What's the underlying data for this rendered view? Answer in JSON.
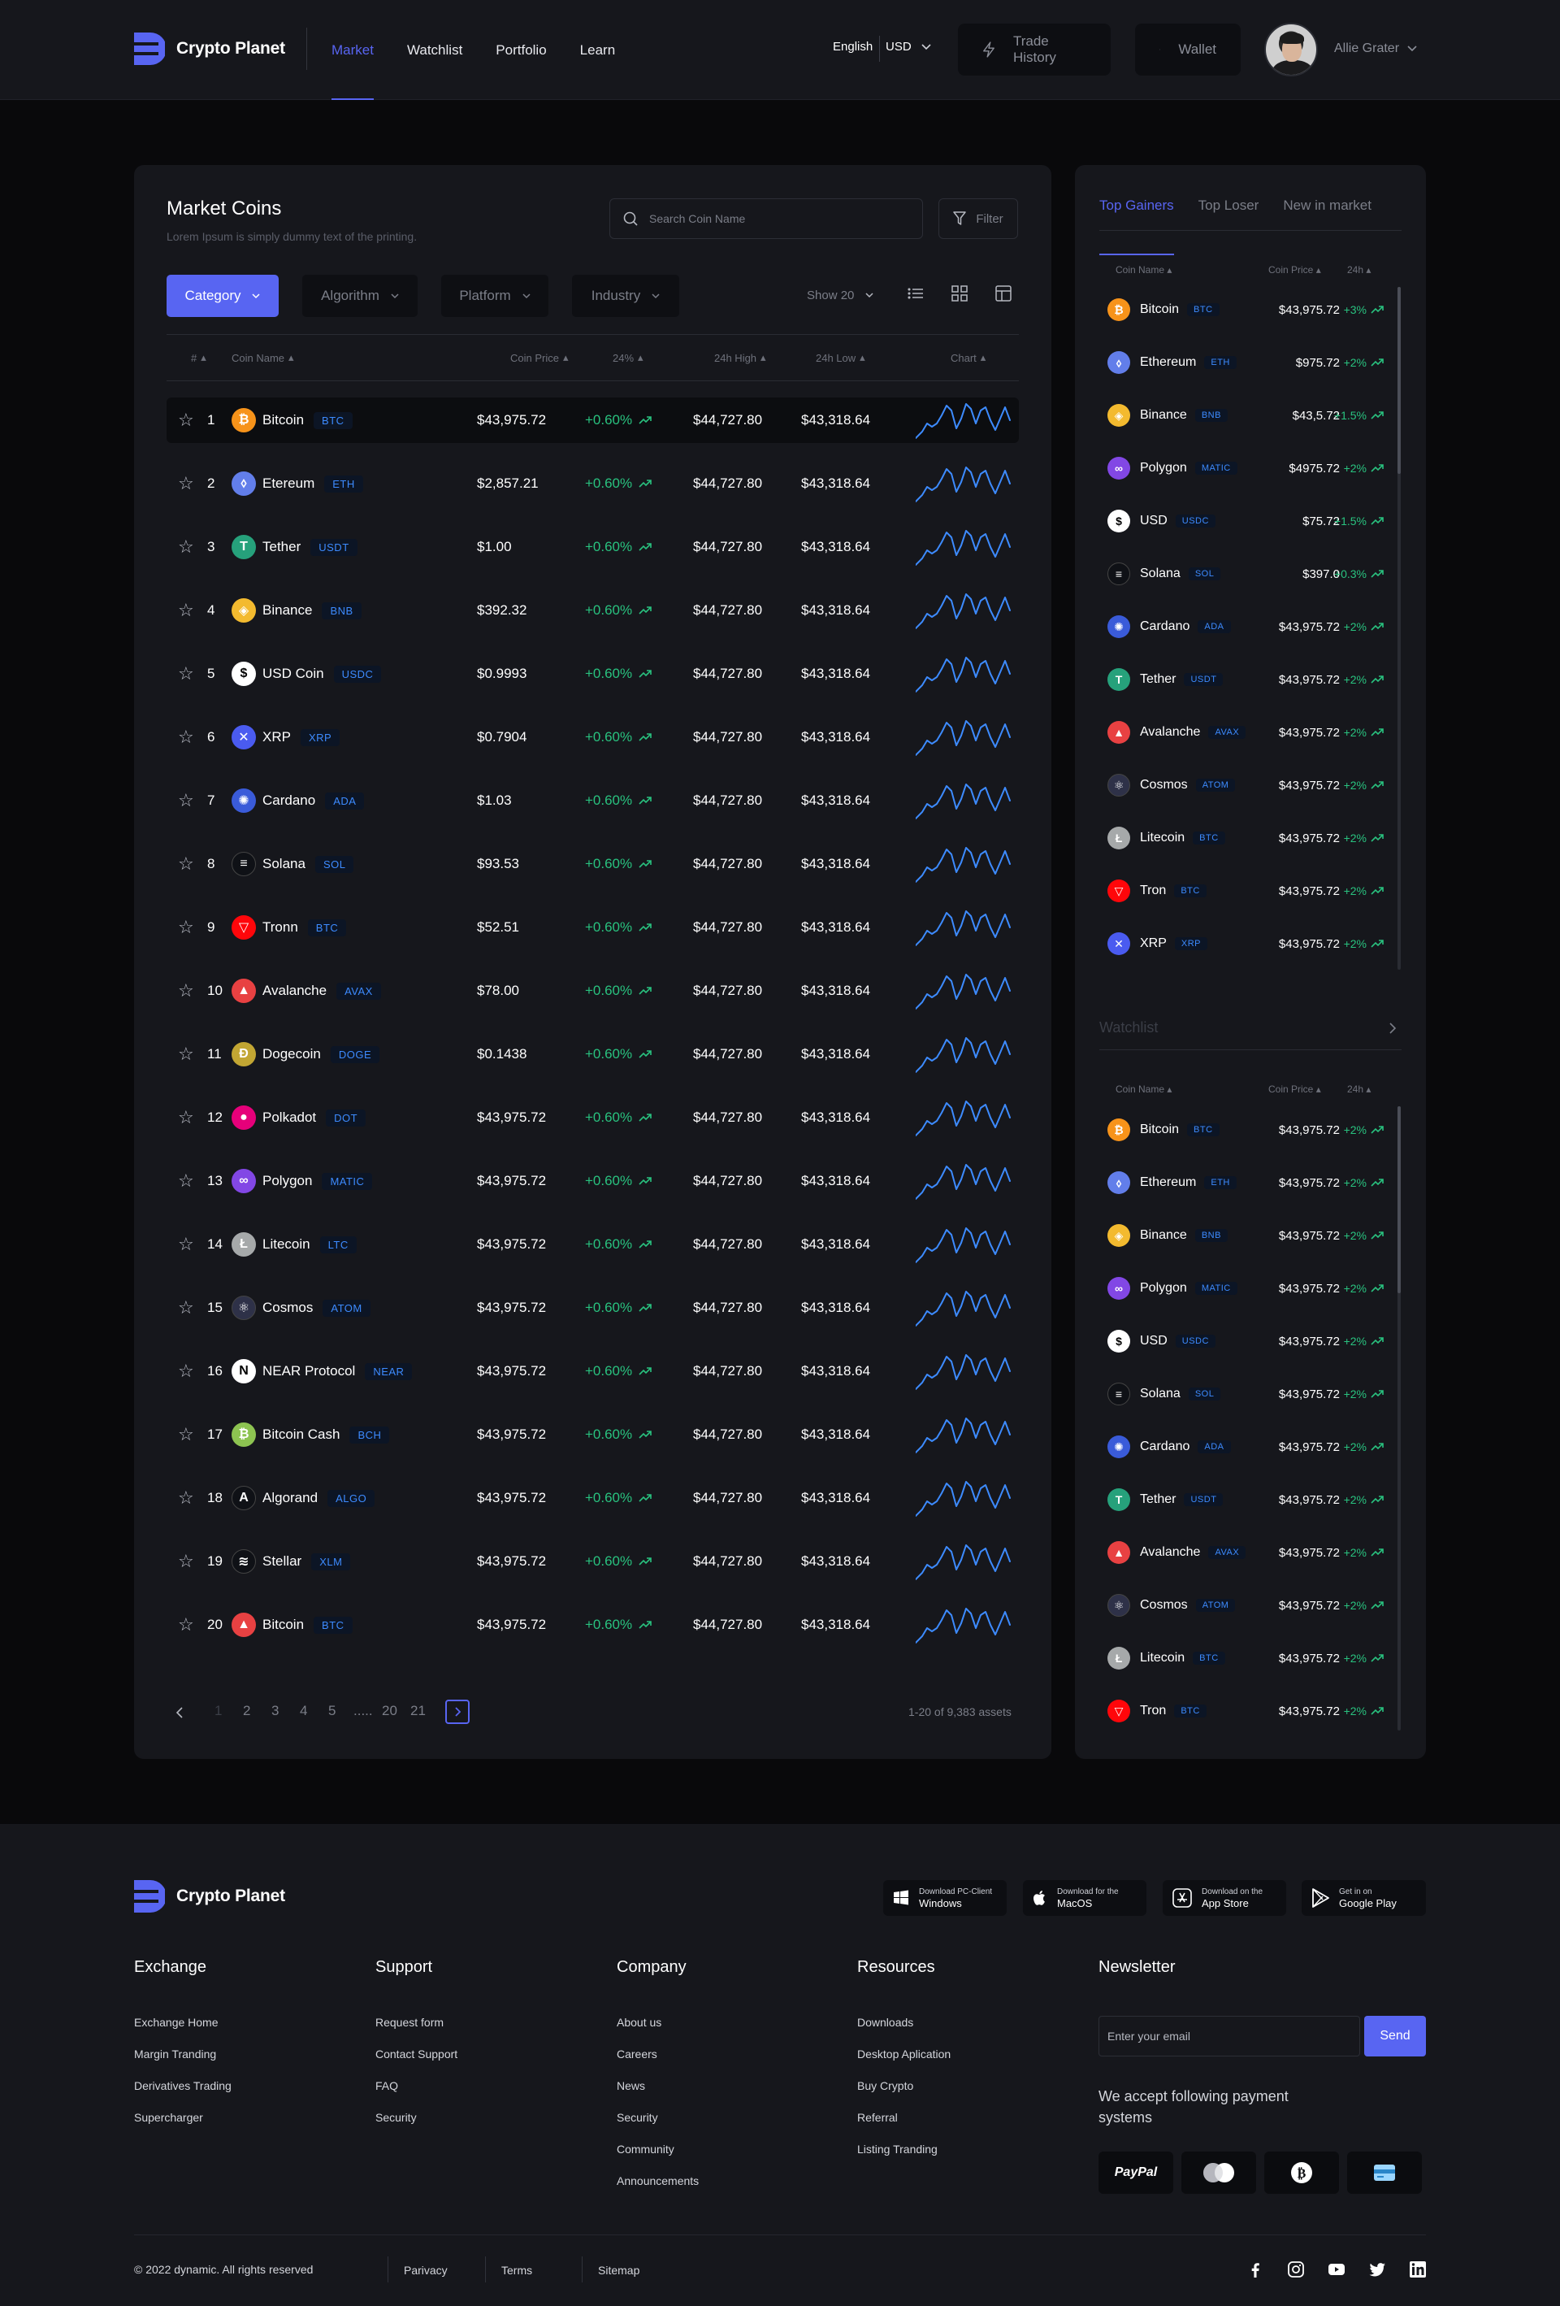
{
  "header": {
    "brand": "Crypto Planet",
    "nav": [
      {
        "label": "Market",
        "active": true
      },
      {
        "label": "Watchlist",
        "active": false
      },
      {
        "label": "Portfolio",
        "active": false
      },
      {
        "label": "Learn",
        "active": false
      }
    ],
    "language": "English",
    "currency": "USD",
    "trade_history_label": "Trade History",
    "wallet_label": "Wallet",
    "user_name": "Allie Grater"
  },
  "market": {
    "title": "Market Coins",
    "subtitle": "Lorem Ipsum is simply dummy text of the printing.",
    "search_placeholder": "Search Coin Name",
    "filter_label": "Filter",
    "chips": [
      "Category",
      "Algorithm",
      "Platform",
      "Industry"
    ],
    "show_label": "Show 20",
    "columns": [
      "#",
      "Coin Name",
      "Coin Price",
      "24%",
      "24h High",
      "24h Low",
      "Chart"
    ],
    "rows": [
      {
        "rank": "1",
        "name": "Bitcoin",
        "symbol": "BTC",
        "price": "$43,975.72",
        "change": "+0.60%",
        "high": "$44,727.80",
        "low": "$43,318.64",
        "icon": "bitcoin-icon"
      },
      {
        "rank": "2",
        "name": "Etereum",
        "symbol": "ETH",
        "price": "$2,857.21",
        "change": "+0.60%",
        "high": "$44,727.80",
        "low": "$43,318.64",
        "icon": "ethereum-icon"
      },
      {
        "rank": "3",
        "name": "Tether",
        "symbol": "USDT",
        "price": "$1.00",
        "change": "+0.60%",
        "high": "$44,727.80",
        "low": "$43,318.64",
        "icon": "tether-icon"
      },
      {
        "rank": "4",
        "name": "Binance",
        "symbol": "BNB",
        "price": "$392.32",
        "change": "+0.60%",
        "high": "$44,727.80",
        "low": "$43,318.64",
        "icon": "binance-icon"
      },
      {
        "rank": "5",
        "name": "USD Coin",
        "symbol": "USDC",
        "price": "$0.9993",
        "change": "+0.60%",
        "high": "$44,727.80",
        "low": "$43,318.64",
        "icon": "usd-coin-icon"
      },
      {
        "rank": "6",
        "name": "XRP",
        "symbol": "XRP",
        "price": "$0.7904",
        "change": "+0.60%",
        "high": "$44,727.80",
        "low": "$43,318.64",
        "icon": "xrp-icon"
      },
      {
        "rank": "7",
        "name": "Cardano",
        "symbol": "ADA",
        "price": "$1.03",
        "change": "+0.60%",
        "high": "$44,727.80",
        "low": "$43,318.64",
        "icon": "cardano-icon"
      },
      {
        "rank": "8",
        "name": "Solana",
        "symbol": "SOL",
        "price": "$93.53",
        "change": "+0.60%",
        "high": "$44,727.80",
        "low": "$43,318.64",
        "icon": "solana-icon"
      },
      {
        "rank": "9",
        "name": "Tronn",
        "symbol": "BTC",
        "price": "$52.51",
        "change": "+0.60%",
        "high": "$44,727.80",
        "low": "$43,318.64",
        "icon": "tron-icon"
      },
      {
        "rank": "10",
        "name": "Avalanche",
        "symbol": "AVAX",
        "price": "$78.00",
        "change": "+0.60%",
        "high": "$44,727.80",
        "low": "$43,318.64",
        "icon": "avalanche-icon"
      },
      {
        "rank": "11",
        "name": "Dogecoin",
        "symbol": "DOGE",
        "price": "$0.1438",
        "change": "+0.60%",
        "high": "$44,727.80",
        "low": "$43,318.64",
        "icon": "dogecoin-icon"
      },
      {
        "rank": "12",
        "name": "Polkadot",
        "symbol": "DOT",
        "price": "$43,975.72",
        "change": "+0.60%",
        "high": "$44,727.80",
        "low": "$43,318.64",
        "icon": "polkadot-icon"
      },
      {
        "rank": "13",
        "name": "Polygon",
        "symbol": "MATIC",
        "price": "$43,975.72",
        "change": "+0.60%",
        "high": "$44,727.80",
        "low": "$43,318.64",
        "icon": "polygon-icon"
      },
      {
        "rank": "14",
        "name": "Litecoin",
        "symbol": "LTC",
        "price": "$43,975.72",
        "change": "+0.60%",
        "high": "$44,727.80",
        "low": "$43,318.64",
        "icon": "litecoin-icon"
      },
      {
        "rank": "15",
        "name": "Cosmos",
        "symbol": "ATOM",
        "price": "$43,975.72",
        "change": "+0.60%",
        "high": "$44,727.80",
        "low": "$43,318.64",
        "icon": "cosmos-icon"
      },
      {
        "rank": "16",
        "name": "NEAR Protocol",
        "symbol": "NEAR",
        "price": "$43,975.72",
        "change": "+0.60%",
        "high": "$44,727.80",
        "low": "$43,318.64",
        "icon": "near-icon"
      },
      {
        "rank": "17",
        "name": "Bitcoin Cash",
        "symbol": "BCH",
        "price": "$43,975.72",
        "change": "+0.60%",
        "high": "$44,727.80",
        "low": "$43,318.64",
        "icon": "bitcoin-cash-icon"
      },
      {
        "rank": "18",
        "name": "Algorand",
        "symbol": "ALGO",
        "price": "$43,975.72",
        "change": "+0.60%",
        "high": "$44,727.80",
        "low": "$43,318.64",
        "icon": "algorand-icon"
      },
      {
        "rank": "19",
        "name": "Stellar",
        "symbol": "XLM",
        "price": "$43,975.72",
        "change": "+0.60%",
        "high": "$44,727.80",
        "low": "$43,318.64",
        "icon": "stellar-icon"
      },
      {
        "rank": "20",
        "name": "Bitcoin",
        "symbol": "BTC",
        "price": "$43,975.72",
        "change": "+0.60%",
        "high": "$44,727.80",
        "low": "$43,318.64",
        "icon": "avalanche-icon"
      }
    ],
    "pagination": [
      "1",
      "2",
      "3",
      "4",
      "5",
      ".....",
      "20",
      "21"
    ],
    "assets_label": "1-20 of 9,383 assets"
  },
  "side": {
    "tabs": [
      "Top Gainers",
      "Top Loser",
      "New in market"
    ],
    "columns": [
      "Coin Name",
      "Coin Price",
      "24h"
    ],
    "gainers": [
      {
        "name": "Bitcoin",
        "symbol": "BTC",
        "price": "$43,975.72",
        "change": "+3%",
        "icon": "bitcoin-icon"
      },
      {
        "name": "Ethereum",
        "symbol": "ETH",
        "price": "$975.72",
        "change": "+2%",
        "icon": "ethereum-icon"
      },
      {
        "name": "Binance",
        "symbol": "BNB",
        "price": "$43,5.72",
        "change": "+1.5%",
        "icon": "binance-icon"
      },
      {
        "name": "Polygon",
        "symbol": "MATIC",
        "price": "$4975.72",
        "change": "+2%",
        "icon": "polygon-icon"
      },
      {
        "name": "USD",
        "symbol": "USDC",
        "price": "$75.72",
        "change": "+1.5%",
        "icon": "usd-coin-icon"
      },
      {
        "name": "Solana",
        "symbol": "SOL",
        "price": "$397.0",
        "change": "+0.3%",
        "icon": "solana-icon"
      },
      {
        "name": "Cardano",
        "symbol": "ADA",
        "price": "$43,975.72",
        "change": "+2%",
        "icon": "cardano-icon"
      },
      {
        "name": "Tether",
        "symbol": "USDT",
        "price": "$43,975.72",
        "change": "+2%",
        "icon": "tether-icon"
      },
      {
        "name": "Avalanche",
        "symbol": "AVAX",
        "price": "$43,975.72",
        "change": "+2%",
        "icon": "avalanche-icon"
      },
      {
        "name": "Cosmos",
        "symbol": "ATOM",
        "price": "$43,975.72",
        "change": "+2%",
        "icon": "cosmos-icon"
      },
      {
        "name": "Litecoin",
        "symbol": "BTC",
        "price": "$43,975.72",
        "change": "+2%",
        "icon": "litecoin-icon"
      },
      {
        "name": "Tron",
        "symbol": "BTC",
        "price": "$43,975.72",
        "change": "+2%",
        "icon": "tron-icon"
      },
      {
        "name": "XRP",
        "symbol": "XRP",
        "price": "$43,975.72",
        "change": "+2%",
        "icon": "xrp-icon"
      }
    ],
    "watchlist_title": "Watchlist",
    "watchlist": [
      {
        "name": "Bitcoin",
        "symbol": "BTC",
        "price": "$43,975.72",
        "change": "+2%",
        "icon": "bitcoin-icon"
      },
      {
        "name": "Ethereum",
        "symbol": "ETH",
        "price": "$43,975.72",
        "change": "+2%",
        "icon": "ethereum-icon"
      },
      {
        "name": "Binance",
        "symbol": "BNB",
        "price": "$43,975.72",
        "change": "+2%",
        "icon": "binance-icon"
      },
      {
        "name": "Polygon",
        "symbol": "MATIC",
        "price": "$43,975.72",
        "change": "+2%",
        "icon": "polygon-icon"
      },
      {
        "name": "USD",
        "symbol": "USDC",
        "price": "$43,975.72",
        "change": "+2%",
        "icon": "usd-coin-icon"
      },
      {
        "name": "Solana",
        "symbol": "SOL",
        "price": "$43,975.72",
        "change": "+2%",
        "icon": "solana-icon"
      },
      {
        "name": "Cardano",
        "symbol": "ADA",
        "price": "$43,975.72",
        "change": "+2%",
        "icon": "cardano-icon"
      },
      {
        "name": "Tether",
        "symbol": "USDT",
        "price": "$43,975.72",
        "change": "+2%",
        "icon": "tether-icon"
      },
      {
        "name": "Avalanche",
        "symbol": "AVAX",
        "price": "$43,975.72",
        "change": "+2%",
        "icon": "avalanche-icon"
      },
      {
        "name": "Cosmos",
        "symbol": "ATOM",
        "price": "$43,975.72",
        "change": "+2%",
        "icon": "cosmos-icon"
      },
      {
        "name": "Litecoin",
        "symbol": "BTC",
        "price": "$43,975.72",
        "change": "+2%",
        "icon": "litecoin-icon"
      },
      {
        "name": "Tron",
        "symbol": "BTC",
        "price": "$43,975.72",
        "change": "+2%",
        "icon": "tron-icon"
      }
    ]
  },
  "footer": {
    "brand": "Crypto Planet",
    "stores": [
      {
        "small": "Download PC-Client",
        "large": "Windows",
        "icon": "windows-icon"
      },
      {
        "small": "Download for the",
        "large": "MacOS",
        "icon": "apple-icon"
      },
      {
        "small": "Download on the",
        "large": "App Store",
        "icon": "app-store-icon"
      },
      {
        "small": "Get in on",
        "large": "Google Play",
        "icon": "google-play-icon"
      }
    ],
    "columns": [
      {
        "title": "Exchange",
        "links": [
          "Exchange Home",
          "Margin Tranding",
          "Derivatives Trading",
          "Supercharger"
        ]
      },
      {
        "title": "Support",
        "links": [
          "Request form",
          "Contact Support",
          "FAQ",
          "Security"
        ]
      },
      {
        "title": "Company",
        "links": [
          "About us",
          "Careers",
          "News",
          "Security",
          "Community",
          "Announcements"
        ]
      },
      {
        "title": "Resources",
        "links": [
          "Downloads",
          "Desktop Aplication",
          "Buy Crypto",
          "Referral",
          "Listing Tranding"
        ]
      }
    ],
    "newsletter_title": "Newsletter",
    "email_placeholder": "Enter your email",
    "send_label": "Send",
    "accept_text": "We accept following payment systems",
    "paypal_label": "PayPal",
    "copyright": "© 2022 dynamic. All rights reserved",
    "bottom_links": [
      "Parivacy",
      "Terms",
      "Sitemap"
    ]
  },
  "colors": {
    "accent": "#5865f2",
    "positive": "#29c27f",
    "symbol": "#3d8bff",
    "panel": "#16171c",
    "background": "#09090b"
  }
}
